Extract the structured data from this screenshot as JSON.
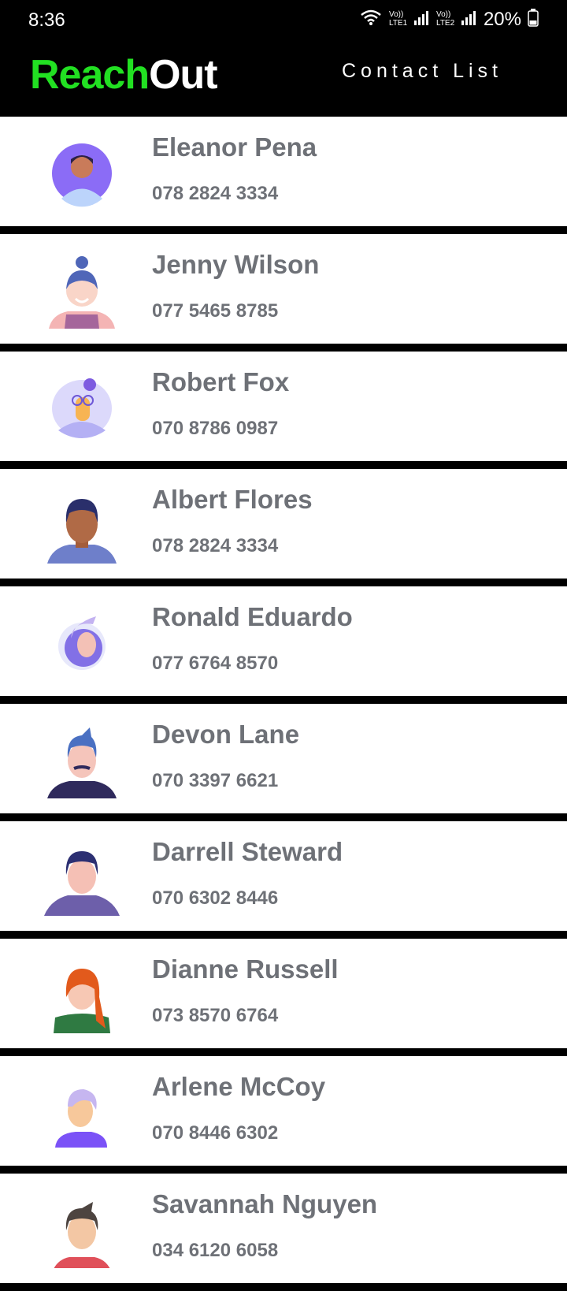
{
  "status_bar": {
    "time": "8:36",
    "battery": "20%",
    "icons": [
      "wifi-icon",
      "lte1-signal-icon",
      "lte2-signal-icon",
      "battery-icon"
    ]
  },
  "header": {
    "brand_part1": "Reach",
    "brand_part2": "Out",
    "title": "Contact List",
    "brand_color": "#22e022"
  },
  "contacts": [
    {
      "name": "Eleanor Pena",
      "phone": "078 2824 3334",
      "avatar": "avatar-man-purple-circle"
    },
    {
      "name": "Jenny Wilson",
      "phone": "077 5465 8785",
      "avatar": "avatar-woman-bun"
    },
    {
      "name": "Robert Fox",
      "phone": "070 8786 0987",
      "avatar": "avatar-man-glasses"
    },
    {
      "name": "Albert Flores",
      "phone": "078 2824 3334",
      "avatar": "avatar-man-dark"
    },
    {
      "name": "Ronald Eduardo",
      "phone": "077 6764 8570",
      "avatar": "avatar-man-purple-hair"
    },
    {
      "name": "Devon Lane",
      "phone": "070 3397 6621",
      "avatar": "avatar-man-mustache"
    },
    {
      "name": "Darrell Steward",
      "phone": "070 6302 8446",
      "avatar": "avatar-man-navy"
    },
    {
      "name": "Dianne Russell",
      "phone": "073 8570 6764",
      "avatar": "avatar-woman-redhair"
    },
    {
      "name": "Arlene McCoy",
      "phone": "070 8446 6302",
      "avatar": "avatar-woman-lavender"
    },
    {
      "name": "Savannah Nguyen",
      "phone": "034 6120 6058",
      "avatar": "avatar-man-brown-hair"
    }
  ]
}
